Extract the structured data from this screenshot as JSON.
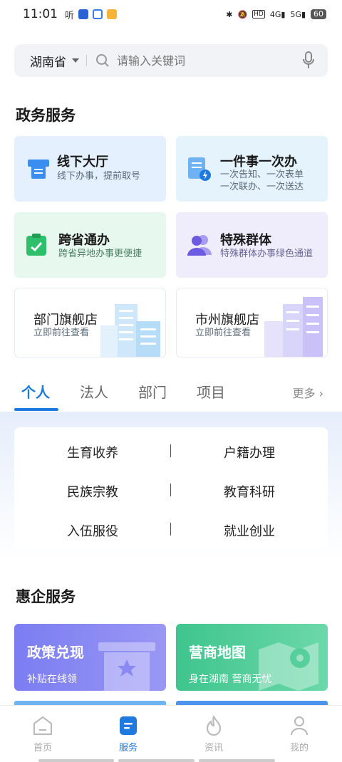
{
  "status": {
    "time": "11:01",
    "battery": "60"
  },
  "search": {
    "province": "湖南省",
    "placeholder": "请输入关键词"
  },
  "gov": {
    "title": "政务服务",
    "cards": [
      {
        "title": "线下大厅",
        "sub": "线下办事，提前取号"
      },
      {
        "title": "一件事一次办",
        "sub1": "一次告知、一次表单",
        "sub2": "一次联办、一次送达"
      },
      {
        "title": "跨省通办",
        "sub": "跨省异地办事更便捷"
      },
      {
        "title": "特殊群体",
        "sub": "特殊群体办事绿色通道"
      },
      {
        "title": "部门旗舰店",
        "sub": "立即前往查看"
      },
      {
        "title": "市州旗舰店",
        "sub": "立即前往查看"
      }
    ]
  },
  "tabs": {
    "items": [
      "个人",
      "法人",
      "部门",
      "项目"
    ],
    "more": "更多"
  },
  "categories": [
    "生育收养",
    "户籍办理",
    "民族宗教",
    "教育科研",
    "入伍服役",
    "就业创业"
  ],
  "biz": {
    "title": "惠企服务",
    "cards": [
      {
        "title": "政策兑现",
        "sub": "补贴在线领"
      },
      {
        "title": "营商地图",
        "sub": "身在湖南 营商无忧"
      }
    ]
  },
  "nav": {
    "items": [
      "首页",
      "服务",
      "资讯",
      "我的"
    ]
  },
  "colors": {
    "accent": "#1f7ae0",
    "card_blue": "#e4f0fd",
    "card_green": "#e7f8ee",
    "card_purple": "#efedfc"
  }
}
